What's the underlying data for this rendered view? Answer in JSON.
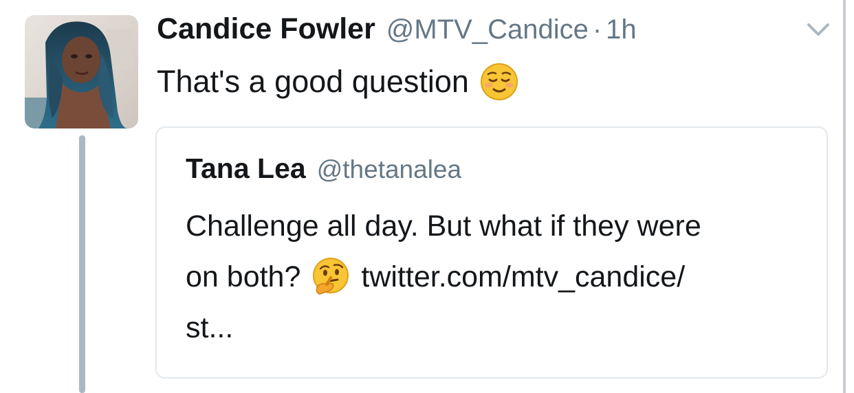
{
  "tweet": {
    "display_name": "Candice Fowler",
    "handle": "@MTV_Candice",
    "separator": "·",
    "time": "1h",
    "text": "That's a good question",
    "emoji": "relieved-face-emoji",
    "menu_icon": "chevron-down-icon"
  },
  "quoted": {
    "display_name": "Tana Lea",
    "handle": "@thetanalea",
    "line1": "Challenge all day. But what if they were",
    "line2_prefix": "on both?",
    "line2_emoji": "thinking-face-emoji",
    "line2_link": "twitter.com/mtv_candice/",
    "line3": "st..."
  },
  "colors": {
    "text": "#14171a",
    "secondary": "#657786",
    "border": "#e1e8ed",
    "thread_line": "#aab8c2"
  }
}
